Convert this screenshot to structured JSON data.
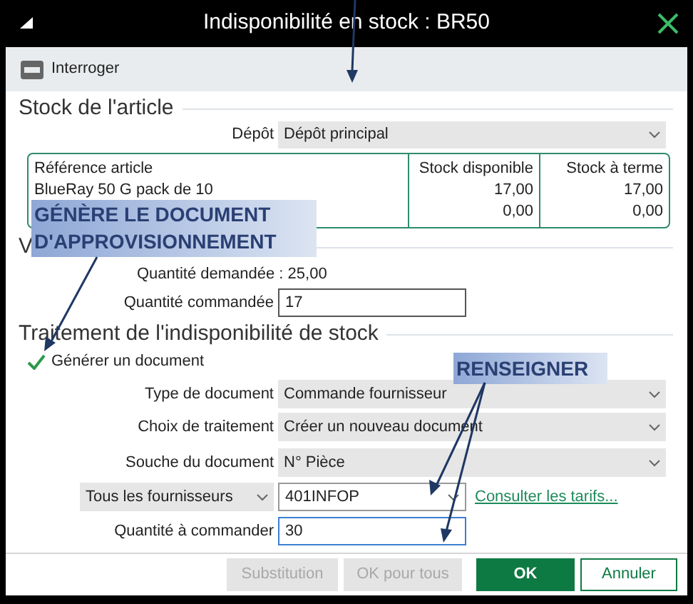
{
  "window": {
    "title": "Indisponibilité en stock : BR50"
  },
  "toolbar": [
    {
      "label": "Interroger"
    }
  ],
  "stock_section": {
    "title": "Stock de l'article",
    "depot": {
      "label": "Dépôt",
      "value": "Dépôt principal"
    },
    "table": {
      "columns": [
        "Référence article",
        "Stock disponible",
        "Stock à terme"
      ],
      "rows": [
        {
          "reference": "BlueRay 50 G pack de 10",
          "available": "17,00",
          "future": "17,00"
        },
        {
          "available": "0,00",
          "future": "0,00"
        }
      ]
    }
  },
  "quantity_section": {
    "title": "V",
    "requested": "Quantité demandée : 25,00",
    "ordered": {
      "label": "Quantité commandée",
      "value": "17"
    }
  },
  "treatment": {
    "title": "Traitement de l'indisponibilité de stock",
    "generate": {
      "label": "Générer un document",
      "checked": true
    },
    "fields": [
      {
        "kind": "select",
        "label": "Type de document",
        "value": "Commande fournisseur"
      },
      {
        "kind": "select",
        "label": "Choix de traitement",
        "value": "Créer un nouveau document"
      },
      {
        "kind": "select",
        "label": "Souche du document",
        "value": "N° Pièce"
      },
      {
        "kind": "supplier",
        "filter": "Tous les fournisseurs",
        "value": "401INFOP",
        "link": "Consulter les tarifs..."
      },
      {
        "kind": "input",
        "label": "Quantité à commander",
        "value": "30",
        "focused": true
      }
    ]
  },
  "buttons": [
    {
      "label": "Substitution",
      "disabled": true,
      "primary": false
    },
    {
      "label": "OK pour tous",
      "disabled": true,
      "primary": false
    },
    {
      "label": "OK",
      "disabled": false,
      "primary": true
    },
    {
      "label": "Annuler",
      "disabled": false,
      "primary": false
    }
  ],
  "annotations": [
    {
      "lines": [
        "GÉNÈRE LE DOCUMENT",
        "D'APPROVISIONNEMENT"
      ]
    },
    {
      "lines": [
        "RENSEIGNER"
      ]
    }
  ]
}
